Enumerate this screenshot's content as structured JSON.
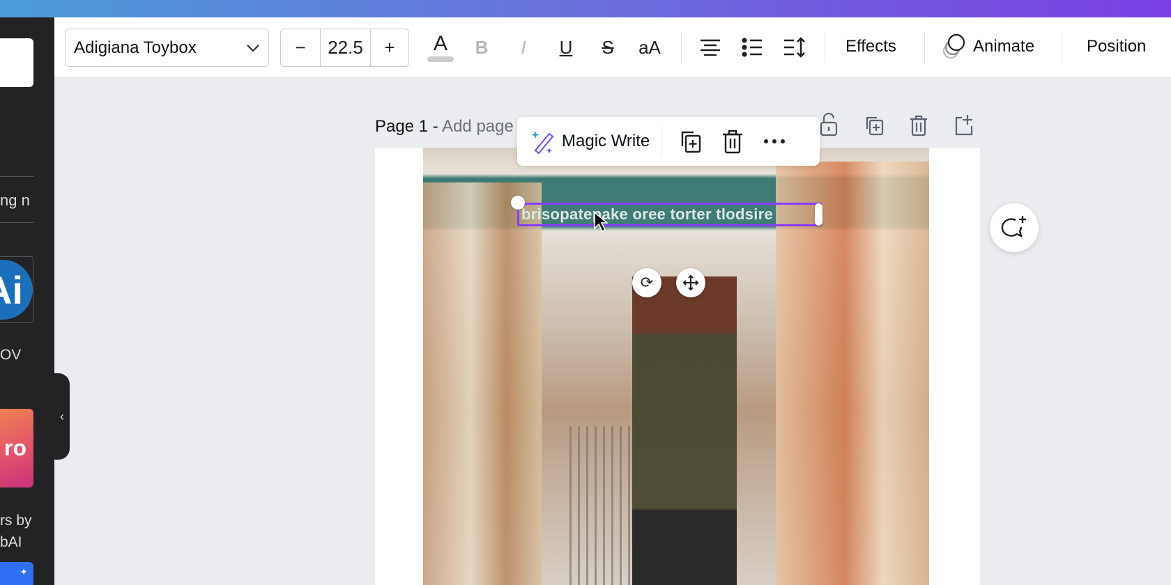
{
  "sidebar": {
    "partial_text_1": "ng n",
    "partial_text_2": "OV",
    "app_badge": "Ai",
    "app_badge_2": "ro",
    "partial_text_3": "rs by",
    "partial_text_4": "bAI",
    "collapse_icon": "chevron-left-icon"
  },
  "toolbar": {
    "font_name": "Adigiana Toybox",
    "font_size": "22.5",
    "decrease": "−",
    "increase": "+",
    "text_color_glyph": "A",
    "bold_glyph": "B",
    "italic_glyph": "I",
    "underline_glyph": "U",
    "strike_glyph": "S",
    "case_glyph": "aA",
    "effects_label": "Effects",
    "animate_label": "Animate",
    "position_label": "Position"
  },
  "page": {
    "title": "Page 1 -",
    "subtitle_placeholder": "Add page"
  },
  "context_menu": {
    "magic_write_label": "Magic Write"
  },
  "canvas": {
    "text_content": "brisopatepake oree torter tlodsire"
  },
  "colors": {
    "accent": "#8b3dff",
    "sidebar_bg": "#232325",
    "canvas_bg": "#ebecf0"
  }
}
